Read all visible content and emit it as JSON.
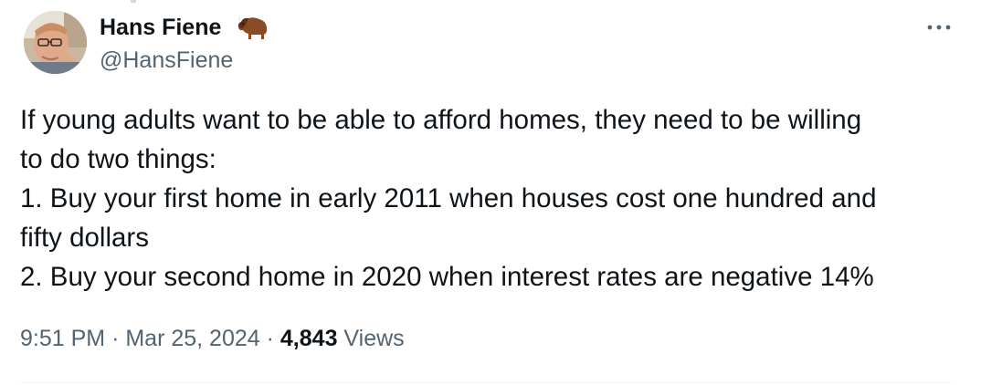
{
  "author": {
    "display_name": "Hans Fiene",
    "handle": "@HansFiene",
    "name_emoji": "bison-icon"
  },
  "tweet": {
    "lines": [
      "If young adults want to be able to afford homes, they need to be willing",
      "to do two things:",
      "1. Buy your first home in early 2011 when houses cost one hundred and",
      "fifty dollars",
      "2. Buy your second home in 2020 when interest rates are negative 14%"
    ]
  },
  "meta": {
    "time": "9:51 PM",
    "separator": "·",
    "date": "Mar 25, 2024",
    "views_count": "4,843",
    "views_label": "Views"
  },
  "icons": {
    "more": "more-horizontal-icon"
  },
  "colors": {
    "text_primary": "#0f1419",
    "text_secondary": "#536471",
    "divider": "#eff3f4",
    "background": "#ffffff"
  }
}
